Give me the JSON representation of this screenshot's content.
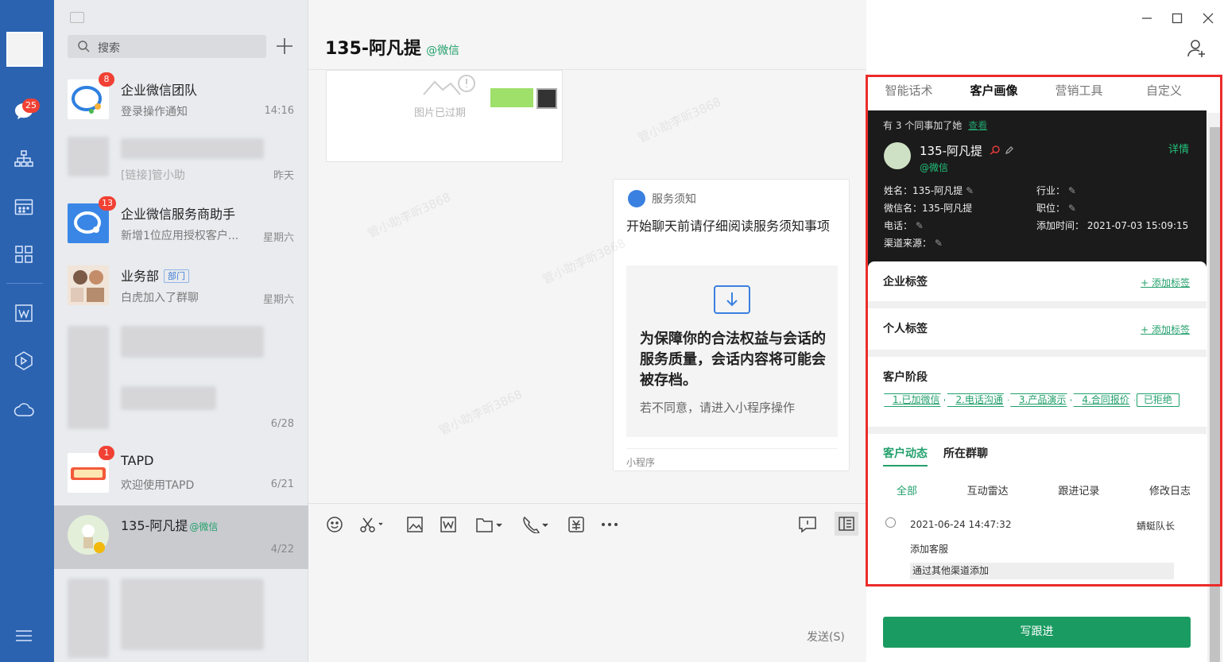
{
  "sidebar": {
    "unread_badge": "25"
  },
  "search": {
    "placeholder": "搜索"
  },
  "conversations": [
    {
      "name": "企业微信团队",
      "message": "登录操作通知",
      "time": "14:16",
      "badge": "8"
    },
    {
      "name": "",
      "message": "[链接]管小助",
      "time": "昨天",
      "badge": ""
    },
    {
      "name": "企业微信服务商助手",
      "message": "新增1位应用授权客户...",
      "time": "星期六",
      "badge": "13"
    },
    {
      "name": "业务部",
      "tag": "部门",
      "message": "白虎加入了群聊",
      "time": "星期六",
      "badge": ""
    },
    {
      "name": "",
      "message": "",
      "time": "6/28",
      "badge": ""
    },
    {
      "name": "TAPD",
      "message": "欢迎使用TAPD",
      "time": "6/21",
      "badge": "1"
    },
    {
      "name": "135-阿凡提",
      "suffix": "@微信",
      "message": "",
      "time": "4/22",
      "badge": ""
    }
  ],
  "chat": {
    "title": "135-阿凡提",
    "title_suffix": "@微信",
    "expired_image_label": "图片已过期",
    "service_card": {
      "header": "服务须知",
      "text": "开始聊天前请仔细阅读服务须知事项",
      "big_text": "为保障你的合法权益与会话的服务质量，会话内容将可能会被存档。",
      "small_text": "若不同意，请进入小程序操作",
      "footer": "小程序"
    },
    "send_label": "发送(S)",
    "watermark": "管小助李昕3868"
  },
  "panel": {
    "tabs": [
      "智能话术",
      "客户画像",
      "营销工具",
      "自定义"
    ],
    "active_tab": "客户画像",
    "colleague_text": "有 3 个同事加了她",
    "colleague_link": "查看",
    "customer_name": "135-阿凡提",
    "customer_source": "@微信",
    "detail_link": "详情",
    "fields": {
      "name": "姓名：135-阿凡提",
      "wechat_name": "微信名：135-阿凡提",
      "phone": "电话：",
      "channel": "渠道来源：",
      "industry": "行业：",
      "position": "职位：",
      "added_time": "添加时间： 2021-07-03 15:09:15"
    },
    "enterprise_tags": {
      "title": "企业标签",
      "add": "+ 添加标签"
    },
    "personal_tags": {
      "title": "个人标签",
      "add": "+ 添加标签"
    },
    "stage": {
      "title": "客户阶段",
      "items": [
        "1.已加微信",
        "2.电话沟通",
        "3.产品演示",
        "4.合同报价",
        "已拒绝"
      ]
    },
    "dynamics_tabs": [
      "客户动态",
      "所在群聊"
    ],
    "filters": [
      "全部",
      "互动雷达",
      "跟进记录",
      "修改日志"
    ],
    "record": {
      "time": "2021-06-24 14:47:32",
      "user": "蜻蜓队长",
      "action": "添加客服",
      "detail": "通过其他渠道添加"
    },
    "write_button": "写跟进"
  }
}
